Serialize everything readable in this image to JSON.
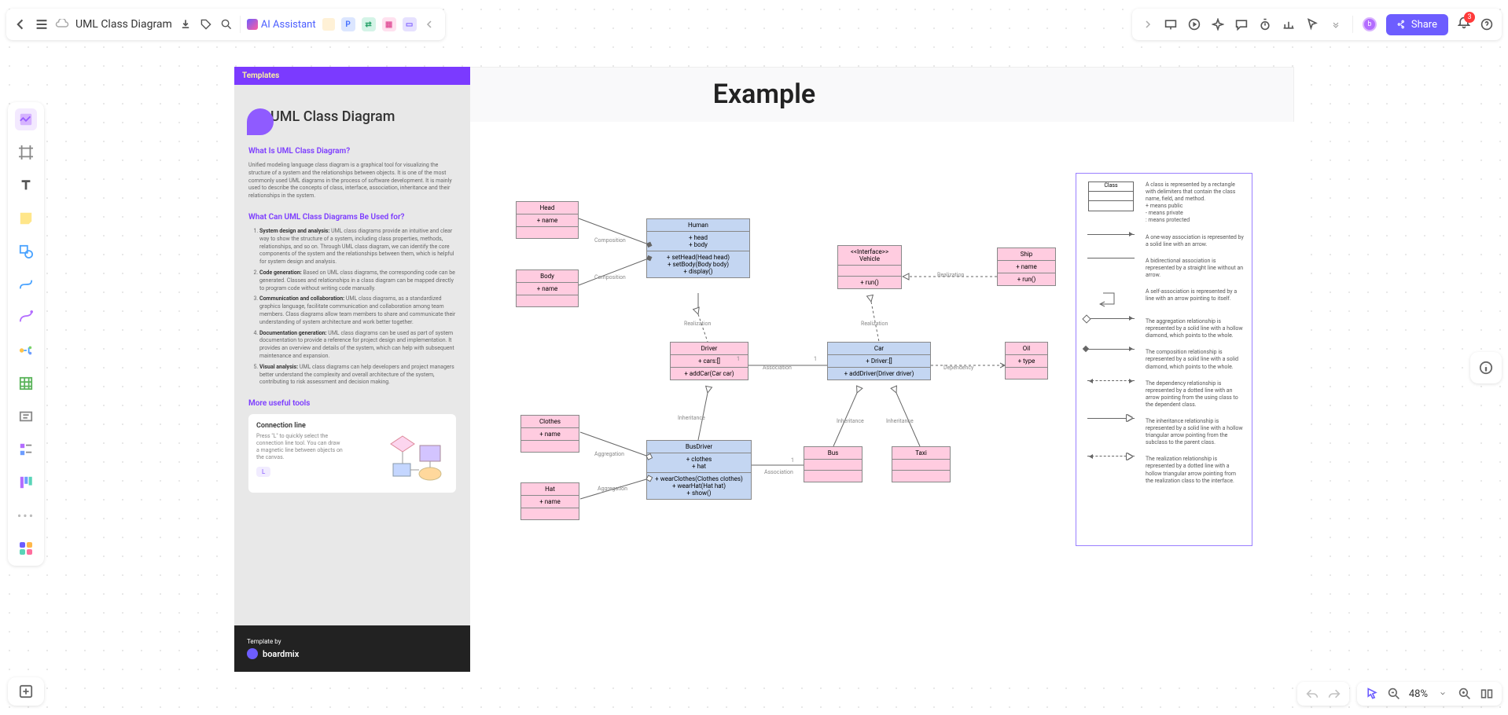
{
  "topbar": {
    "title": "UML Class Diagram",
    "ai_label": "AI Assistant",
    "share_label": "Share",
    "notifications": "3"
  },
  "tool_badges": [
    "P"
  ],
  "panel": {
    "templates_label": "Templates",
    "heading": "UML Class Diagram",
    "q1": "What Is UML Class Diagram?",
    "p1": "Unified modeling language class diagram is a graphical tool for visualizing the structure of a system and the relationships between objects. It is one of the most commonly used UML diagrams in the process of software development. It is mainly used to describe the concepts of class, interface, association, inheritance and their relationships in the system.",
    "q2": "What Can UML Class Diagrams Be Used for?",
    "items": [
      {
        "b": "System design and analysis:",
        "t": " UML class diagrams provide an intuitive and clear way to show the structure of a system, including class properties, methods, relationships, and so on. Through UML class diagram, we can identify the core components of the system and the relationships between them, which is helpful for system design and analysis."
      },
      {
        "b": "Code generation:",
        "t": " Based on UML class diagrams, the corresponding code can be generated. Classes and relationships in a class diagram can be mapped directly to program code without writing code manually."
      },
      {
        "b": "Communication and collaboration:",
        "t": " UML class diagrams, as a standardized graphics language, facilitate communication and collaboration among team members. Class diagrams allow team members to share and communicate their understanding of system architecture and work better together."
      },
      {
        "b": "Documentation generation:",
        "t": " UML class diagrams can be used as part of system documentation to provide a reference for project design and implementation. It provides an overview and details of the system, which can help with subsequent maintenance and expansion."
      },
      {
        "b": "Visual analysis:",
        "t": " UML class diagrams can help developers and project managers better understand the complexity and overall architecture of the system, contributing to risk assessment and decision making."
      }
    ],
    "q3": "More useful tools",
    "tool_title": "Connection line",
    "tool_text": "Press \"L\" to quickly select the connection line tool. You can draw a magnetic line between objects on the canvas.",
    "tool_key": "L",
    "template_by": "Template by",
    "brand": "boardmix"
  },
  "example_title": "Example",
  "classes": {
    "head": {
      "name": "Head",
      "attrs": "+ name"
    },
    "body": {
      "name": "Body",
      "attrs": "+ name"
    },
    "human": {
      "name": "Human",
      "attrs": "+ head\n+ body",
      "methods": "+ setHead(Head head)\n+ setBody(Body body)\n+ display()"
    },
    "vehicle": {
      "name": "<<Interface>>\nVehicle",
      "methods": "+ run()"
    },
    "ship": {
      "name": "Ship",
      "attrs": "+ name",
      "methods": "+ run()"
    },
    "driver": {
      "name": "Driver",
      "attrs": "+ cars:[]",
      "methods": "+ addCar(Car car)"
    },
    "car": {
      "name": "Car",
      "attrs": "+ Driver:[]",
      "methods": "+ addDriver(Driver driver)"
    },
    "oil": {
      "name": "Oil",
      "attrs": "+ type"
    },
    "clothes": {
      "name": "Clothes",
      "attrs": "+ name"
    },
    "hat": {
      "name": "Hat",
      "attrs": "+ name"
    },
    "busdriver": {
      "name": "BusDriver",
      "attrs": "+ clothes\n+ hat",
      "methods": "+ wearClothes(Clothes clothes)\n+ wearHat(Hat hat)\n+ show()"
    },
    "bus": {
      "name": "Bus"
    },
    "taxi": {
      "name": "Taxi"
    }
  },
  "labels": {
    "composition": "Composition",
    "realization": "Realization",
    "association": "Association",
    "dependency": "Dependency",
    "inheritance": "Inheritance",
    "aggregation": "Aggregation",
    "one": "1"
  },
  "legend": {
    "class_label": "Class",
    "class_desc": "A class is represented by a rectangle with delimiters that contain the class name, field, and method.",
    "class_bullets": "+ means public\n-  means private\n:  means protected",
    "assoc1": "A one-way association is represented by a solid line with an arrow.",
    "assoc2": "A bidirectional association is represented by a straight line without an arrow.",
    "self": "A self-association is represented by a line with an arrow pointing to itself.",
    "agg": "The aggregation relationship is represented by a solid line with a hollow diamond, which points to the whole.",
    "comp": "The composition relationship is represented by a solid line with a solid diamond, which points to the whole.",
    "dep": "The dependency relationship is represented by a dotted line with an arrow pointing from the using class to the dependent class.",
    "inh": "The inheritance relationship is represented by a solid line with a hollow triangular arrow pointing from the subclass to the parent class.",
    "real": "The realization relationship is represented by a dotted line with a hollow triangular arrow pointing from the realization class to the interface."
  },
  "zoom": "48%"
}
